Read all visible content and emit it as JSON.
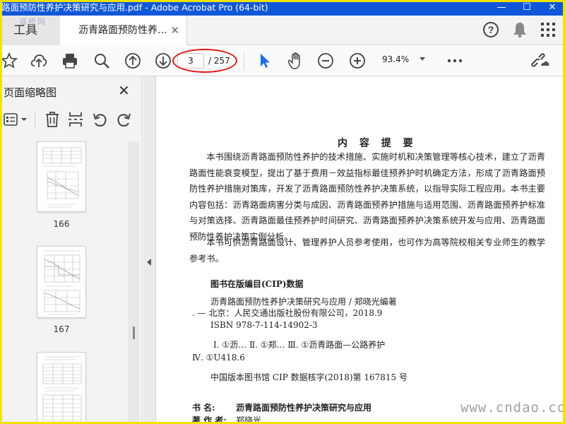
{
  "window": {
    "title": "路面预防性养护决策研究与应用.pdf - Adobe Acrobat Pro (64-bit)",
    "controls": {
      "minimize": "—",
      "maximize": "☐",
      "close": "✕"
    }
  },
  "tabbar": {
    "tools_label": "工具",
    "doc_tab_label": "沥青路面预防性养...",
    "tab_close": "✕"
  },
  "toolbar": {
    "current_page": "3",
    "total_pages": "/ 257",
    "zoom": "93.4%"
  },
  "left_panel": {
    "title": "页面缩略图",
    "close": "✕",
    "thumbnails": [
      {
        "label": "166"
      },
      {
        "label": "167"
      },
      {
        "label": ""
      }
    ]
  },
  "document": {
    "heading": "内 容 提 要",
    "paragraph1": "本书围绕沥青路面预防性养护的技术措施、实施时机和决策管理等核心技术，建立了沥青路面性能衰变模型，提出了基于费用－效益指标最佳预养护时机确定方法，形成了沥青路面预防性养护措施对策库，开发了沥青路面预防性养护决策系统，以指导实际工程应用。本书主要内容包括：沥青路面病害分类与成因、沥青路面预养护措施与适用范围、沥青路面预养护标准与对策选择、沥青路面最佳预养护时间研究、沥青路面预养护决策系统开发与应用、沥青路面预防性养护决策实例分析。",
    "paragraph2": "本书可供沥青路面设计、管理养护人员参考使用，也可作为高等院校相关专业师生的教学参考书。",
    "cip_heading": "图书在版编目(CIP)数据",
    "cip_line1": "沥青路面预防性养护决策研究与应用 / 郑晓光编著",
    "cip_line2": ". — 北京：人民交通出版社股份有限公司，2018.9",
    "cip_line3": "ISBN  978-7-114-14902-3",
    "cip_line4": "Ⅰ. ①沥…   Ⅱ. ①郑…   Ⅲ. ①沥青路面—公路养护",
    "cip_line5": "Ⅳ. ①U418.6",
    "cip_line6": "中国版本图书馆 CIP 数据核字(2018)第 167815 号",
    "book_name_label": "书    名:",
    "book_name": "沥青路面预防性养护决策研究与应用",
    "author_label": "著 作 者:",
    "author": "郑晓光"
  },
  "watermarks": {
    "corner": "道桥网",
    "site": "www.cndao.com"
  },
  "colors": {
    "titlebar": "#0f57d8",
    "frame": "#f2e200",
    "highlight_ellipse": "#e01818",
    "select_tool": "#1a6ee0"
  }
}
